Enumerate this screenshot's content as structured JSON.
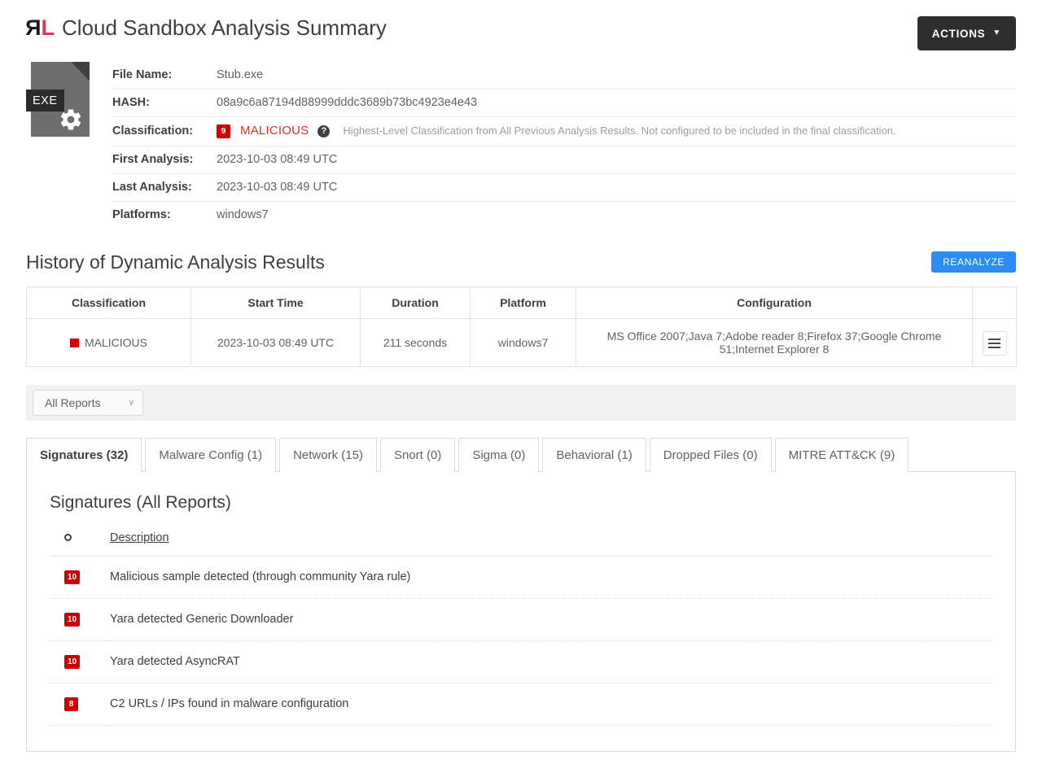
{
  "header": {
    "logo_r": "R",
    "logo_l": "L",
    "title": "Cloud Sandbox Analysis Summary",
    "actions_label": "ACTIONS",
    "actions_caret": "▼"
  },
  "file": {
    "icon_ext": "EXE",
    "icon_name": "exe-file-icon",
    "rows": [
      {
        "key": "File Name:",
        "value": "Stub.exe"
      },
      {
        "key": "HASH:",
        "value": "08a9c6a87194d88999dddc3689b73bc4923e4e43"
      },
      {
        "key": "Classification:",
        "value": ""
      },
      {
        "key": "First Analysis:",
        "value": "2023-10-03 08:49 UTC"
      },
      {
        "key": "Last Analysis:",
        "value": "2023-10-03 08:49 UTC"
      },
      {
        "key": "Platforms:",
        "value": "windows7"
      }
    ],
    "classification": {
      "score": "9",
      "label": "MALICIOUS",
      "help_glyph": "?",
      "hint": "Highest-Level Classification from All Previous Analysis Results. Not configured to be included in the final classification.",
      "color": "#d93025",
      "badge_color": "#cc0000"
    }
  },
  "history": {
    "section_title": "History of Dynamic Analysis Results",
    "reanalyze_label": "REANALYZE",
    "reanalyze_color": "#2a8cf5",
    "columns": [
      "Classification",
      "Start Time",
      "Duration",
      "Platform",
      "Configuration",
      ""
    ],
    "rows": [
      {
        "classification": "MALICIOUS",
        "classification_color": "#d40000",
        "start_time": "2023-10-03 08:49 UTC",
        "duration": "211 seconds",
        "platform": "windows7",
        "configuration": "MS Office 2007;Java 7;Adobe reader 8;Firefox 37;Google Chrome 51;Internet Explorer 8"
      }
    ]
  },
  "filter": {
    "selected": "All Reports",
    "chevron": "∨"
  },
  "tabs": [
    {
      "label": "Signatures (32)",
      "active": true
    },
    {
      "label": "Malware Config (1)",
      "active": false
    },
    {
      "label": "Network (15)",
      "active": false
    },
    {
      "label": "Snort (0)",
      "active": false
    },
    {
      "label": "Sigma (0)",
      "active": false
    },
    {
      "label": "Behavioral (1)",
      "active": false
    },
    {
      "label": "Dropped Files (0)",
      "active": false
    },
    {
      "label": "MITRE ATT&CK (9)",
      "active": false
    }
  ],
  "panel": {
    "title": "Signatures (All Reports)",
    "col_score_icon": "circle-icon",
    "col_description": "Description",
    "signatures": [
      {
        "score": "10",
        "description": "Malicious sample detected (through community Yara rule)"
      },
      {
        "score": "10",
        "description": "Yara detected Generic Downloader"
      },
      {
        "score": "10",
        "description": "Yara detected AsyncRAT"
      },
      {
        "score": "8",
        "description": "C2 URLs / IPs found in malware configuration"
      }
    ]
  }
}
